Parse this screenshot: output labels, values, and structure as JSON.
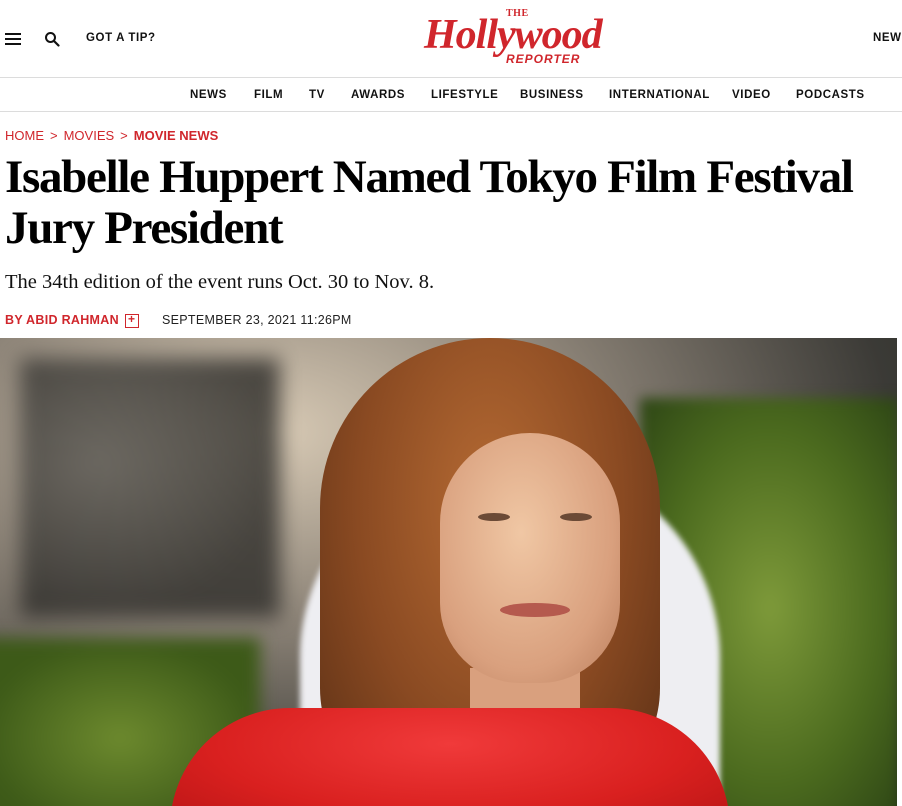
{
  "header": {
    "tip_label": "GOT A TIP?",
    "right_cut_label": "NEW",
    "logo": {
      "top": "THE",
      "main": "Hollywood",
      "bottom": "REPORTER"
    }
  },
  "nav": {
    "items": [
      "NEWS",
      "FILM",
      "TV",
      "AWARDS",
      "LIFESTYLE",
      "BUSINESS",
      "INTERNATIONAL",
      "VIDEO",
      "PODCASTS"
    ]
  },
  "breadcrumb": {
    "items": [
      "HOME",
      "MOVIES",
      "MOVIE NEWS"
    ]
  },
  "article": {
    "headline": "Isabelle Huppert Named Tokyo Film Festival Jury President",
    "dek": "The 34th edition of the event runs Oct. 30 to Nov. 8.",
    "byline": "BY ABID RAHMAN",
    "date": "SEPTEMBER 23, 2021 11:26PM"
  },
  "colors": {
    "brand": "#d0262c"
  }
}
